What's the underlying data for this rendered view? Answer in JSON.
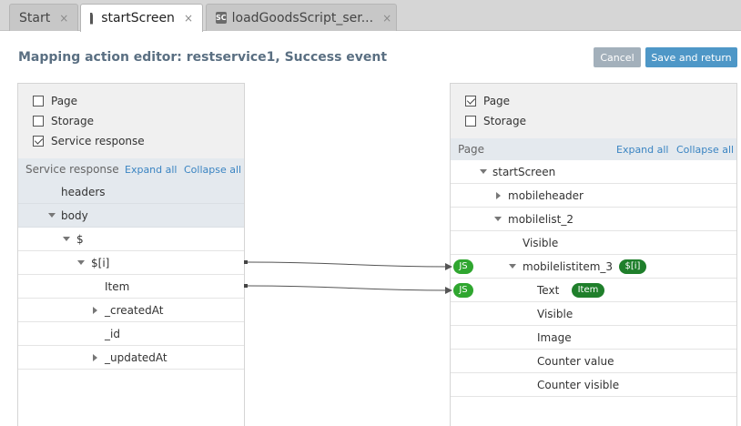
{
  "tabs": [
    {
      "label": "Start",
      "close": "×"
    },
    {
      "label": "startScreen",
      "close": "×"
    },
    {
      "label": "loadGoodsScript_ser...",
      "close": "×",
      "icon_text": "SC"
    }
  ],
  "title": "Mapping action editor: restservice1, Success event",
  "buttons": {
    "cancel": "Cancel",
    "save": "Save and return"
  },
  "left": {
    "options": [
      "Page",
      "Storage",
      "Service response"
    ],
    "header": {
      "label": "Service response",
      "expand": "Expand all",
      "collapse": "Collapse all"
    },
    "rows": [
      "headers",
      "body",
      "$",
      "$[i]",
      "Item",
      "_createdAt",
      "_id",
      "_updatedAt"
    ]
  },
  "right": {
    "options": [
      "Page",
      "Storage"
    ],
    "header": {
      "label": "Page",
      "expand": "Expand all",
      "collapse": "Collapse all"
    },
    "rows": [
      "startScreen",
      "mobileheader",
      "mobilelist_2",
      "Visible",
      "mobilelistitem_3",
      "Text",
      "Visible",
      "Image",
      "Counter value",
      "Counter visible"
    ],
    "badges": {
      "js": "JS",
      "index": "$[i]",
      "item": "Item"
    }
  },
  "colors": {
    "accent": "#4e97c7",
    "badge_js": "#2fa62f",
    "badge_dark": "#1f7f2b"
  }
}
